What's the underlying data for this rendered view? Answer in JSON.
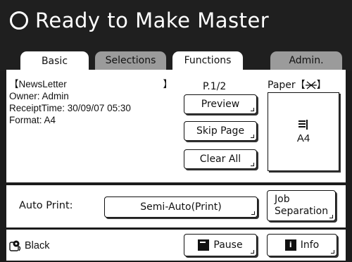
{
  "header": {
    "title": "Ready to Make Master",
    "status_icon": "ring-icon"
  },
  "tabs": [
    {
      "label": "Basic",
      "active": true
    },
    {
      "label": "Selections",
      "active": false
    },
    {
      "label": "Functions",
      "active": false
    },
    {
      "label": "Admin.",
      "active": false
    }
  ],
  "job": {
    "name_open": "【NewsLetter",
    "name_close": "】",
    "owner": "Owner: Admin",
    "receipt_time": "ReceiptTime: 30/09/07 05:30",
    "format": "Format: A4"
  },
  "preview": {
    "page": "P.1/2",
    "preview_label": "Preview",
    "skip_label": "Skip Page",
    "clear_label": "Clear All"
  },
  "paper": {
    "title": "Paper【",
    "title_close": "】",
    "size": "A4",
    "doc_icon": "document-icon"
  },
  "auto_print": {
    "label": "Auto Print:",
    "value": "Semi-Auto(Print)",
    "job_sep_line1": "Job",
    "job_sep_line2": "Separation"
  },
  "footer": {
    "color": "Black",
    "pause_label": "Pause",
    "info_label": "Info"
  }
}
